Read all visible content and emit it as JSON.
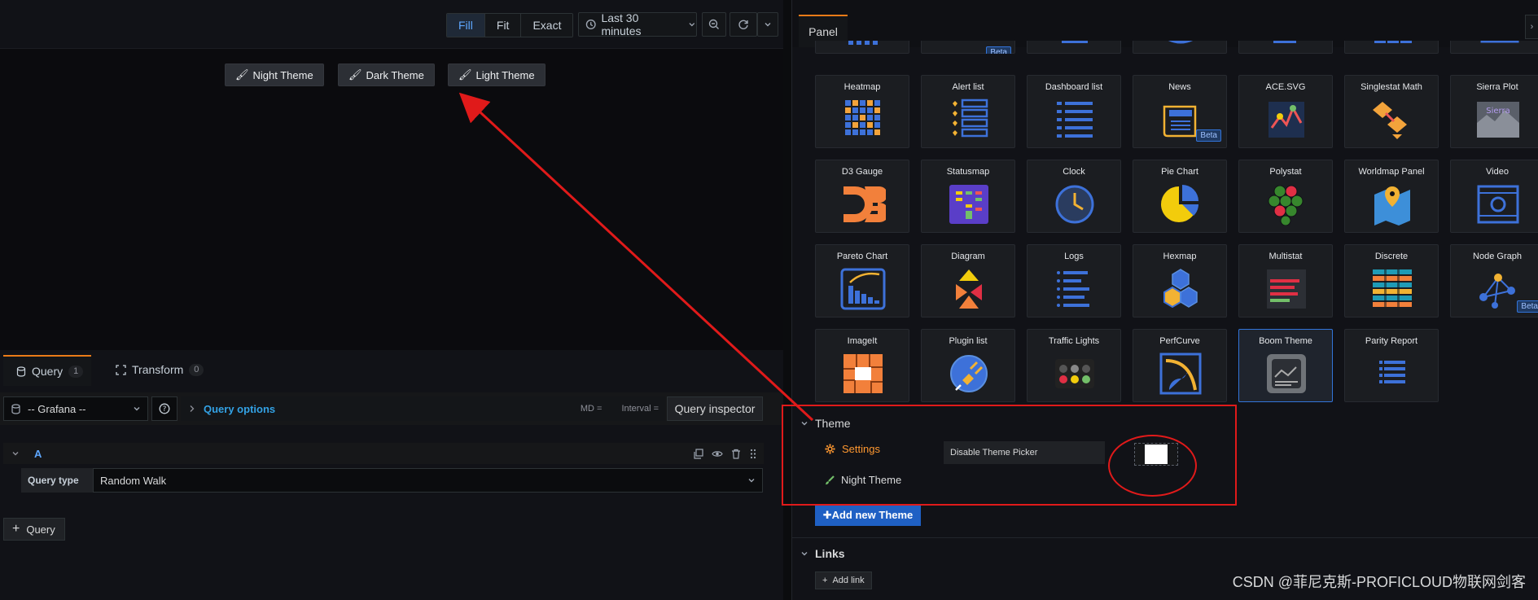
{
  "toolbar": {
    "fill_label": "Fill",
    "fit_label": "Fit",
    "exact_label": "Exact",
    "time_range": "Last 30 minutes"
  },
  "preview": {
    "theme_buttons": [
      "Night Theme",
      "Dark Theme",
      "Light Theme"
    ]
  },
  "query": {
    "tabs": [
      {
        "label": "Query",
        "count": "1"
      },
      {
        "label": "Transform",
        "count": "0"
      }
    ],
    "datasource": "-- Grafana --",
    "query_options_label": "Query options",
    "md_label": "MD =",
    "interval_label": "Interval =",
    "inspector_label": "Query inspector",
    "row_letter": "A",
    "query_type_label": "Query type",
    "query_type_value": "Random Walk",
    "add_query_label": "Query"
  },
  "panel": {
    "tab_label": "Panel",
    "beta_label": "Beta",
    "visualizations": [
      {
        "name": "Heatmap",
        "icon": "heatmap-icon",
        "beta": false
      },
      {
        "name": "Alert list",
        "icon": "alert-list-icon",
        "beta": false
      },
      {
        "name": "Dashboard list",
        "icon": "dashboard-list-icon",
        "beta": false
      },
      {
        "name": "News",
        "icon": "news-icon",
        "beta": true
      },
      {
        "name": "ACE.SVG",
        "icon": "ace-svg-icon",
        "beta": false
      },
      {
        "name": "Singlestat Math",
        "icon": "singlestat-math-icon",
        "beta": false
      },
      {
        "name": "Sierra Plot",
        "icon": "sierra-plot-icon",
        "beta": false
      },
      {
        "name": "D3 Gauge",
        "icon": "d3-gauge-icon",
        "beta": false
      },
      {
        "name": "Statusmap",
        "icon": "statusmap-icon",
        "beta": false
      },
      {
        "name": "Clock",
        "icon": "clock-icon",
        "beta": false
      },
      {
        "name": "Pie Chart",
        "icon": "pie-chart-icon",
        "beta": false
      },
      {
        "name": "Polystat",
        "icon": "polystat-icon",
        "beta": false
      },
      {
        "name": "Worldmap Panel",
        "icon": "worldmap-icon",
        "beta": false
      },
      {
        "name": "Video",
        "icon": "video-icon",
        "beta": false
      },
      {
        "name": "Pareto Chart",
        "icon": "pareto-chart-icon",
        "beta": false
      },
      {
        "name": "Diagram",
        "icon": "diagram-icon",
        "beta": false
      },
      {
        "name": "Logs",
        "icon": "logs-icon",
        "beta": false
      },
      {
        "name": "Hexmap",
        "icon": "hexmap-icon",
        "beta": false
      },
      {
        "name": "Multistat",
        "icon": "multistat-icon",
        "beta": false
      },
      {
        "name": "Discrete",
        "icon": "discrete-icon",
        "beta": false
      },
      {
        "name": "Node Graph",
        "icon": "node-graph-icon",
        "beta": true
      },
      {
        "name": "ImageIt",
        "icon": "imageit-icon",
        "beta": false
      },
      {
        "name": "Plugin list",
        "icon": "plugin-list-icon",
        "beta": false
      },
      {
        "name": "Traffic Lights",
        "icon": "traffic-lights-icon",
        "beta": false
      },
      {
        "name": "PerfCurve",
        "icon": "perfcurve-icon",
        "beta": false
      },
      {
        "name": "Boom Theme",
        "icon": "boom-theme-icon",
        "beta": false,
        "selected": true
      },
      {
        "name": "Parity Report",
        "icon": "parity-report-icon",
        "beta": false
      }
    ]
  },
  "theme": {
    "section_title": "Theme",
    "settings_label": "Settings",
    "night_theme_label": "Night Theme",
    "disable_picker_label": "Disable Theme Picker",
    "add_button_label": "✚Add new Theme"
  },
  "links": {
    "section_title": "Links",
    "add_link_label": "Add link"
  },
  "watermark": "CSDN @菲尼克斯-PROFICLOUD物联网剑客",
  "colors": {
    "accent_blue": "#3274d9",
    "annotation_red": "#e01a1a",
    "settings_orange": "#ff9830",
    "night_theme_green": "#73bf69"
  }
}
